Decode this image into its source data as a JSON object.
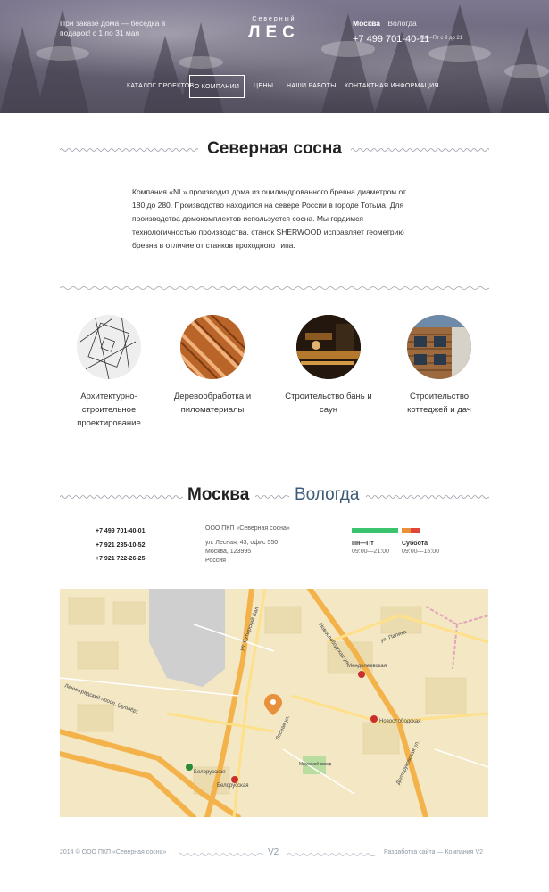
{
  "header": {
    "promo_text": "При заказе дома — беседка в подарок! с 1 по 31 мая",
    "logo_top": "Северный",
    "logo_main": "ЛЕС",
    "city_active": "Москва",
    "city_other": "Вологда",
    "phone": "+7 499 701-40-11",
    "hours": "Пн—Пт с 9 до 21"
  },
  "nav": {
    "items": [
      "Каталог проектов",
      "О компании",
      "Цены",
      "Наши работы",
      "Контактная информация"
    ]
  },
  "about": {
    "title": "Северная сосна",
    "text": "Компания «NL» производит дома из оцилиндрованного бревна диаметром от 180 до 280. Производство находится на севере России в городе Тотьма. Для производства домокомплектов используется сосна. Мы гордимся технологичностью производства, станок SHERWOOD исправляет геометрию бревна в отличие от станков проходного типа."
  },
  "services": [
    {
      "label": "Архитектурно-строительное проектирование",
      "icon": "blueprint-image"
    },
    {
      "label": "Деревообработка и пиломатериалы",
      "icon": "lumber-image"
    },
    {
      "label": "Строительство бань и саун",
      "icon": "sauna-image"
    },
    {
      "label": "Строительство коттеджей и дач",
      "icon": "cottage-image"
    }
  ],
  "offices": {
    "tab_active": "Москва",
    "tab_other": "Вологда",
    "phones": [
      "+7 499 701-40-01",
      "+7 921 235-10-52",
      "+7 921 722-26-25"
    ],
    "company_name": "ООО ПКП «Северная сосна»",
    "address_line1": "ул. Лесная, 43, офис 550",
    "address_line2": "Москва, 123995",
    "address_line3": "Россия",
    "schedule": [
      {
        "day": "Пн—Пт",
        "time": "09:00—21:00",
        "color": "#3cc36d"
      },
      {
        "day": "Суббота",
        "time": "09:00—15:00",
        "color": "#e8903a"
      }
    ]
  },
  "map": {
    "labels": {
      "belorusskaya": "Белорусская",
      "mendeleevskaya": "Менделеевская",
      "novoslobodskaya": "Новослободская",
      "street_palikha": "ул. Палиха",
      "street_butyrsky": "ул. Бутырский Вал",
      "street_leningradsky": "Ленинградский просп. (дублёр)",
      "street_dolgorukovskaya": "Долгоруковская ул.",
      "street_lesnaya": "Лесная ул.",
      "street_novoslobodskaya": "Новослободская ул.",
      "sq_miusskaya": "Миусский сквер"
    },
    "marker_icon": "map-pin-icon"
  },
  "footer": {
    "copyright": "2014 © ООО ПКП «Северная сосна»",
    "dev": "Разработка сайта — Компания V2",
    "logo": "V2"
  },
  "colors": {
    "accent_blue": "#3d5a78",
    "green": "#3cc36d",
    "orange": "#e8903a",
    "red": "#e0463a"
  }
}
